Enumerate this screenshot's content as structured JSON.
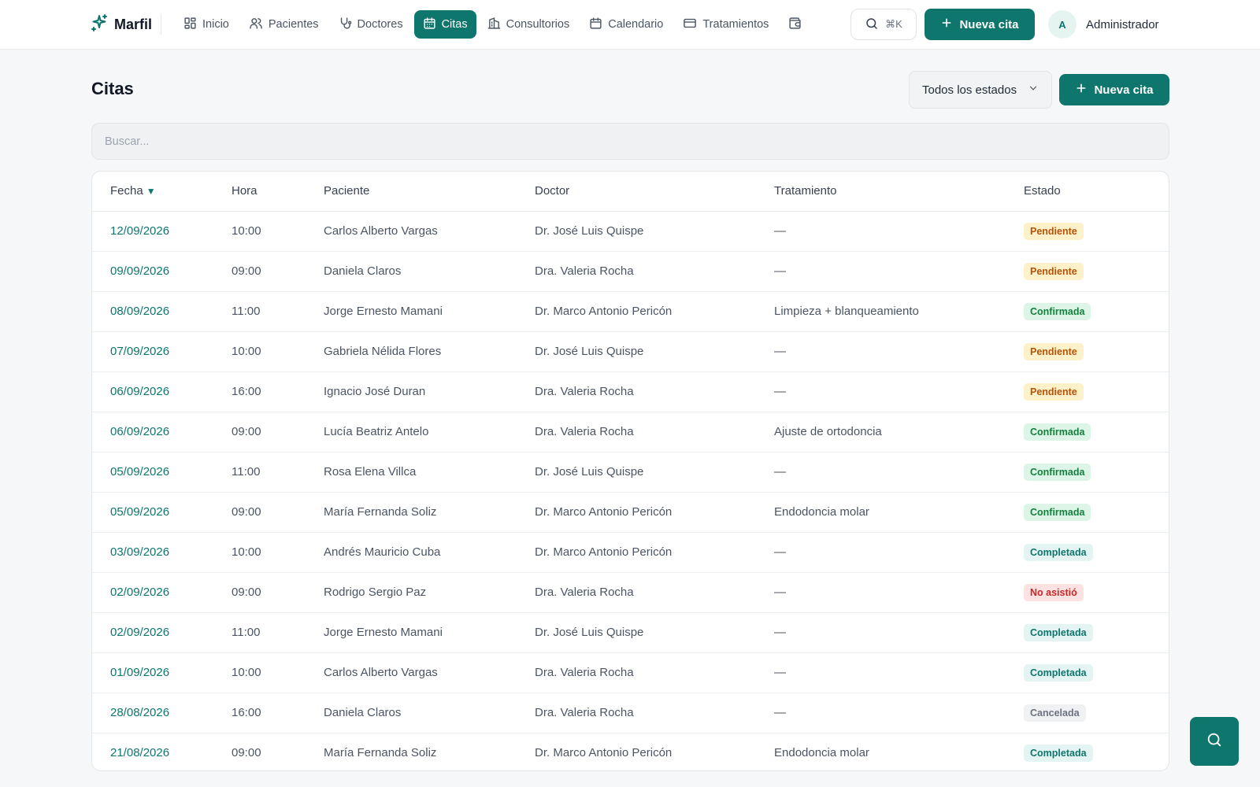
{
  "brand": {
    "name": "Marfil"
  },
  "nav": [
    {
      "label": "Inicio",
      "icon": "grid-icon",
      "active": false
    },
    {
      "label": "Pacientes",
      "icon": "users-icon",
      "active": false
    },
    {
      "label": "Doctores",
      "icon": "stethoscope-icon",
      "active": false
    },
    {
      "label": "Citas",
      "icon": "calendar-grid-icon",
      "active": true
    },
    {
      "label": "Consultorios",
      "icon": "building-icon",
      "active": false
    },
    {
      "label": "Calendario",
      "icon": "calendar-icon",
      "active": false
    },
    {
      "label": "Tratamientos",
      "icon": "credit-card-icon",
      "active": false
    },
    {
      "label": "",
      "icon": "wallet-icon",
      "active": false
    }
  ],
  "search_shortcut": "⌘K",
  "top_new_label": "Nueva cita",
  "user": {
    "initial": "A",
    "name": "Administrador"
  },
  "page": {
    "title": "Citas",
    "status_filter": "Todos los estados",
    "new_label": "Nueva cita",
    "search_placeholder": "Buscar..."
  },
  "table": {
    "headers": {
      "date": "Fecha",
      "time": "Hora",
      "patient": "Paciente",
      "doctor": "Doctor",
      "treatment": "Tratamiento",
      "status": "Estado"
    },
    "rows": [
      {
        "date": "12/09/2026",
        "time": "10:00",
        "patient": "Carlos Alberto Vargas",
        "doctor": "Dr. José Luis Quispe",
        "treatment": "—",
        "status": "Pendiente"
      },
      {
        "date": "09/09/2026",
        "time": "09:00",
        "patient": "Daniela Claros",
        "doctor": "Dra. Valeria Rocha",
        "treatment": "—",
        "status": "Pendiente"
      },
      {
        "date": "08/09/2026",
        "time": "11:00",
        "patient": "Jorge Ernesto Mamani",
        "doctor": "Dr. Marco Antonio Pericón",
        "treatment": "Limpieza + blanqueamiento",
        "status": "Confirmada"
      },
      {
        "date": "07/09/2026",
        "time": "10:00",
        "patient": "Gabriela Nélida Flores",
        "doctor": "Dr. José Luis Quispe",
        "treatment": "—",
        "status": "Pendiente"
      },
      {
        "date": "06/09/2026",
        "time": "16:00",
        "patient": "Ignacio José Duran",
        "doctor": "Dra. Valeria Rocha",
        "treatment": "—",
        "status": "Pendiente"
      },
      {
        "date": "06/09/2026",
        "time": "09:00",
        "patient": "Lucía Beatriz Antelo",
        "doctor": "Dra. Valeria Rocha",
        "treatment": "Ajuste de ortodoncia",
        "status": "Confirmada"
      },
      {
        "date": "05/09/2026",
        "time": "11:00",
        "patient": "Rosa Elena Villca",
        "doctor": "Dr. José Luis Quispe",
        "treatment": "—",
        "status": "Confirmada"
      },
      {
        "date": "05/09/2026",
        "time": "09:00",
        "patient": "María Fernanda Soliz",
        "doctor": "Dr. Marco Antonio Pericón",
        "treatment": "Endodoncia molar",
        "status": "Confirmada"
      },
      {
        "date": "03/09/2026",
        "time": "10:00",
        "patient": "Andrés Mauricio Cuba",
        "doctor": "Dr. Marco Antonio Pericón",
        "treatment": "—",
        "status": "Completada"
      },
      {
        "date": "02/09/2026",
        "time": "09:00",
        "patient": "Rodrigo Sergio Paz",
        "doctor": "Dra. Valeria Rocha",
        "treatment": "—",
        "status": "No asistió"
      },
      {
        "date": "02/09/2026",
        "time": "11:00",
        "patient": "Jorge Ernesto Mamani",
        "doctor": "Dr. José Luis Quispe",
        "treatment": "—",
        "status": "Completada"
      },
      {
        "date": "01/09/2026",
        "time": "10:00",
        "patient": "Carlos Alberto Vargas",
        "doctor": "Dra. Valeria Rocha",
        "treatment": "—",
        "status": "Completada"
      },
      {
        "date": "28/08/2026",
        "time": "16:00",
        "patient": "Daniela Claros",
        "doctor": "Dra. Valeria Rocha",
        "treatment": "—",
        "status": "Cancelada"
      },
      {
        "date": "21/08/2026",
        "time": "09:00",
        "patient": "María Fernanda Soliz",
        "doctor": "Dr. Marco Antonio Pericón",
        "treatment": "Endodoncia molar",
        "status": "Completada"
      }
    ]
  },
  "colors": {
    "brand": "#0f766e",
    "pendiente": "#b45309",
    "confirmada": "#15803d",
    "completada": "#0f766e",
    "no_asistio": "#c62828",
    "cancelada": "#6b7280"
  },
  "fab_icon": "search-icon"
}
